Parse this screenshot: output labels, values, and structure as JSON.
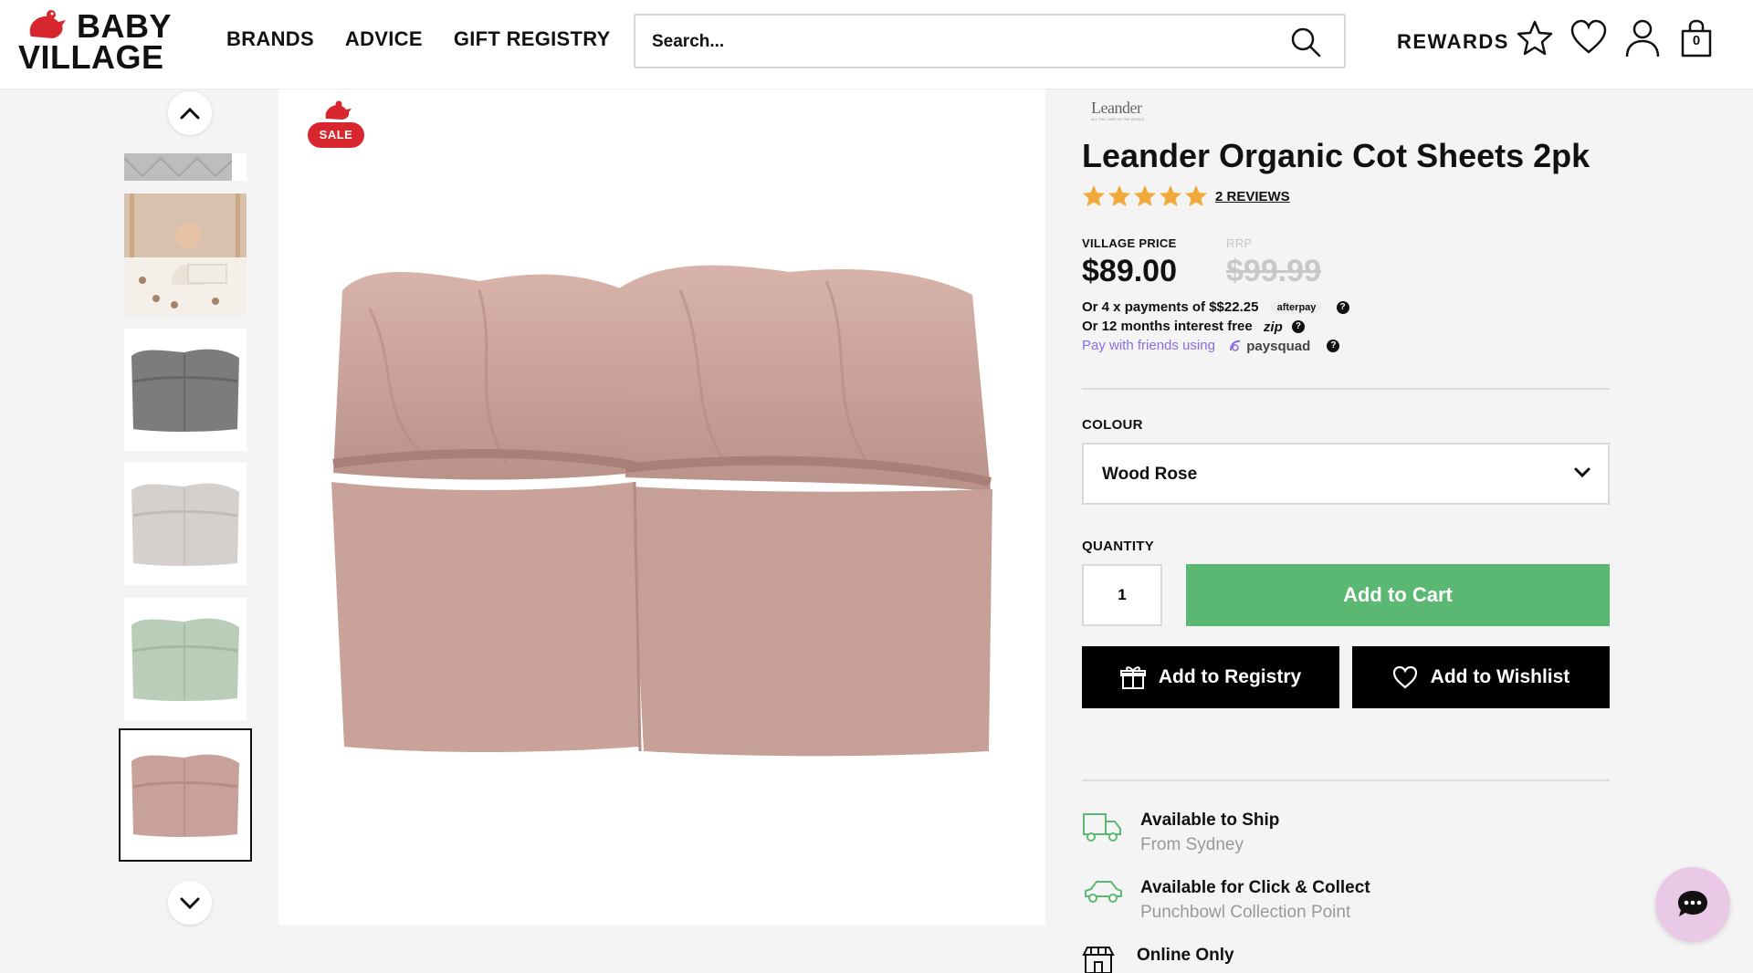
{
  "header": {
    "logo_line1": "BABY",
    "logo_line2": "VILLAGE",
    "nav": [
      {
        "label": "BRANDS"
      },
      {
        "label": "ADVICE"
      },
      {
        "label": "GIFT REGISTRY"
      }
    ],
    "search_placeholder": "Search...",
    "rewards_label": "REWARDS",
    "bag_count": "0",
    "icons": [
      "search-icon",
      "star-icon",
      "heart-icon",
      "user-icon",
      "bag-icon"
    ]
  },
  "gallery": {
    "thumbnails": [
      {
        "name": "quilted-partial",
        "color": "#bdbdbd"
      },
      {
        "name": "lifestyle-photo",
        "color": "#d8c2ad"
      },
      {
        "name": "grey-sheets",
        "color": "#7d7c7a"
      },
      {
        "name": "cappuccino-sheets",
        "color": "#d6d0cc"
      },
      {
        "name": "sage-sheets",
        "color": "#b9cdb9"
      },
      {
        "name": "wood-rose-sheets",
        "color": "#c8a29a",
        "selected": true
      }
    ],
    "sale_label": "SALE",
    "sheet_color": "#c9a39a"
  },
  "product": {
    "brand": "Leander",
    "brand_sub": "ALL THE CARE IN THE WORLD",
    "title": "Leander Organic Cot Sheets 2pk",
    "rating": 5,
    "reviews_label": "2 REVIEWS",
    "village_price_label": "VILLAGE PRICE",
    "village_price": "$89.00",
    "rrp_label": "RRP",
    "rrp_price": "$99.99",
    "afterpay_text": "Or 4 x payments of $$22.25",
    "afterpay_brand": "afterpay",
    "zip_text": "Or 12 months interest free",
    "zip_brand": "zip",
    "paysquad_text": "Pay with friends using",
    "paysquad_brand": "paysquad",
    "help_mark": "?",
    "colour_label": "COLOUR",
    "colour_value": "Wood Rose",
    "quantity_label": "QUANTITY",
    "quantity_value": "1",
    "add_to_cart": "Add to Cart",
    "add_to_registry": "Add to Registry",
    "add_to_wishlist": "Add to Wishlist",
    "availability": [
      {
        "title": "Available to Ship",
        "subtitle": "From Sydney"
      },
      {
        "title": "Available for Click & Collect",
        "subtitle": "Punchbowl Collection Point"
      },
      {
        "title": "Online Only",
        "subtitle": ""
      }
    ]
  },
  "colors": {
    "accent_green": "#5bb872",
    "sale_red": "#d8262e",
    "paysquad_purple": "#8a6de0",
    "chat_bubble": "#e9c9e6"
  }
}
